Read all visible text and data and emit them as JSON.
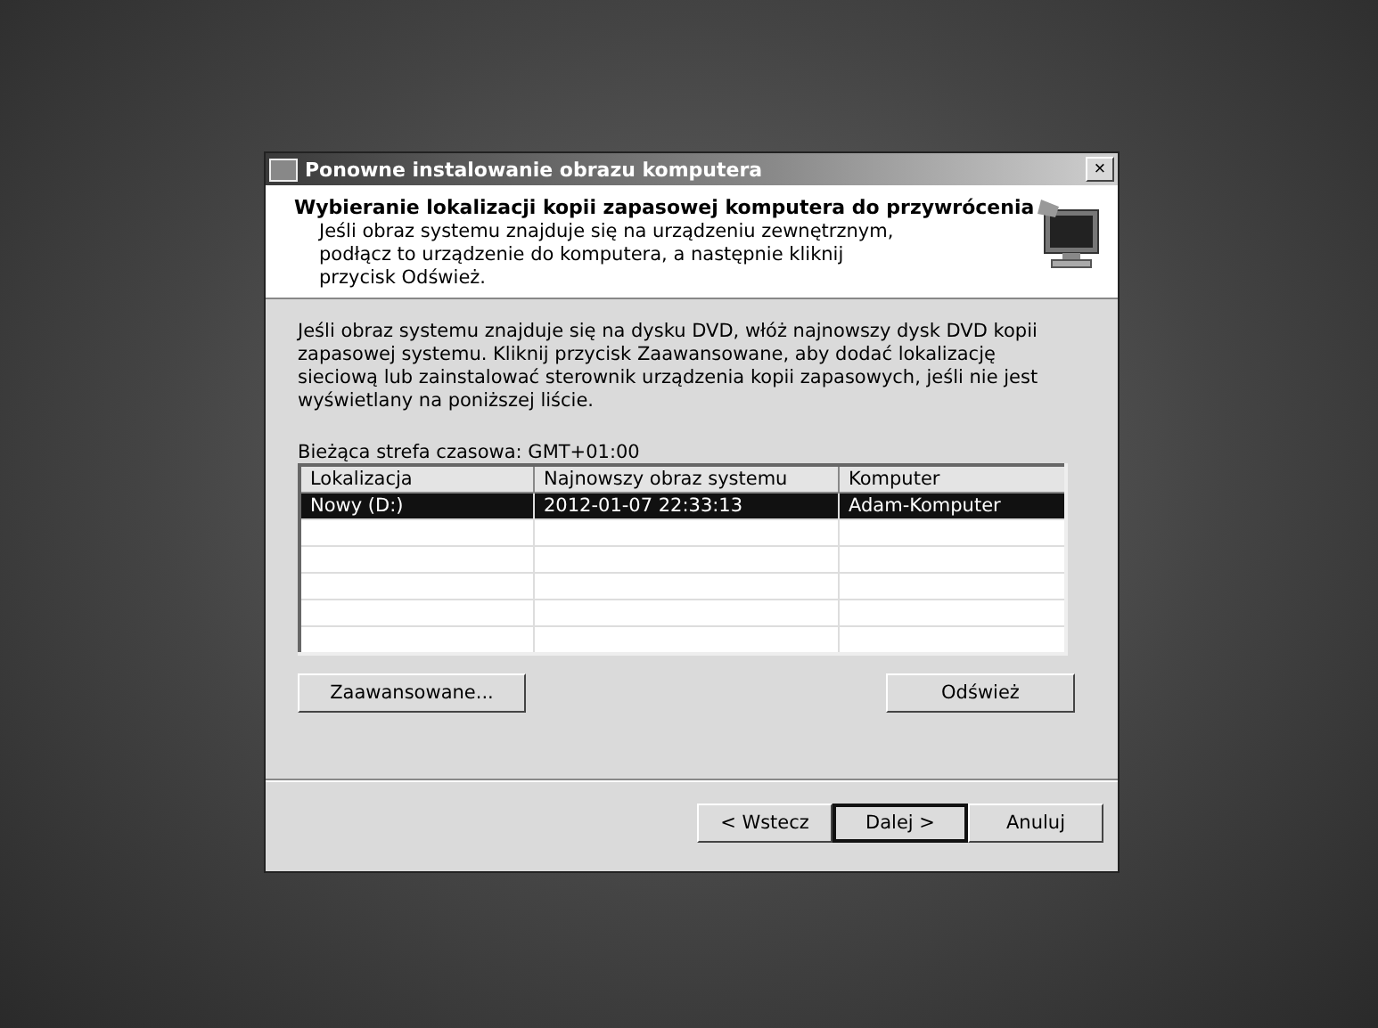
{
  "window": {
    "title": "Ponowne instalowanie obrazu komputera",
    "close": "×"
  },
  "header": {
    "title": "Wybieranie lokalizacji kopii zapasowej komputera do przywrócenia",
    "subtitle": "Jeśli obraz systemu znajduje się na urządzeniu zewnętrznym, podłącz to urządzenie do komputera, a następnie kliknij przycisk Odśwież."
  },
  "instructions": "Jeśli obraz systemu znajduje się na dysku DVD, włóż najnowszy dysk DVD kopii zapasowej systemu. Kliknij przycisk Zaawansowane, aby dodać lokalizację sieciową lub zainstalować sterownik urządzenia kopii zapasowych, jeśli nie jest wyświetlany na poniższej liście.",
  "timezone": "Bieżąca strefa czasowa: GMT+01:00",
  "table": {
    "columns": [
      "Lokalizacja",
      "Najnowszy obraz systemu",
      "Komputer"
    ],
    "rows": [
      {
        "cells": [
          "Nowy (D:)",
          "2012-01-07 22:33:13",
          "Adam-Komputer"
        ],
        "selected": true
      }
    ]
  },
  "actions": [
    "Zaawansowane...",
    "Odśwież"
  ],
  "buttons": [
    {
      "label": "< Wstecz",
      "default": false
    },
    {
      "label": "Dalej >",
      "default": true
    },
    {
      "label": "Anuluj",
      "default": false
    }
  ]
}
